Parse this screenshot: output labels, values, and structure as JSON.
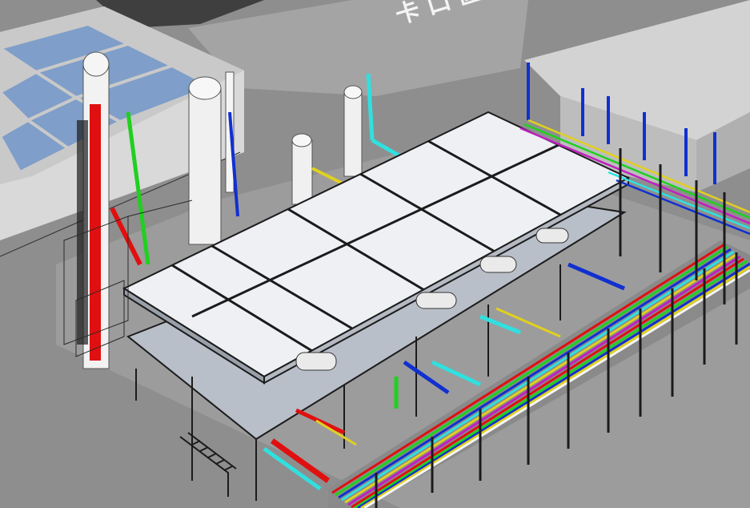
{
  "scene": {
    "ground_marking": "卡 口 區",
    "colors": {
      "ground": "#8e8e8e",
      "pad": "#a6a6a6",
      "wall": "#c8c8c8",
      "roof": "#e4e6ec",
      "glass": "#7f9ec9",
      "road": "#4a4a4a",
      "steel": "#1b1b1b",
      "vessel": "#f2f2f2",
      "pipe_red": "#e01010",
      "pipe_green": "#20d020",
      "pipe_blue": "#1030d0",
      "pipe_cyan": "#30e0e0",
      "pipe_yellow": "#e0d020",
      "pipe_magenta": "#c020c0",
      "pipe_white": "#f5f5f5"
    }
  }
}
